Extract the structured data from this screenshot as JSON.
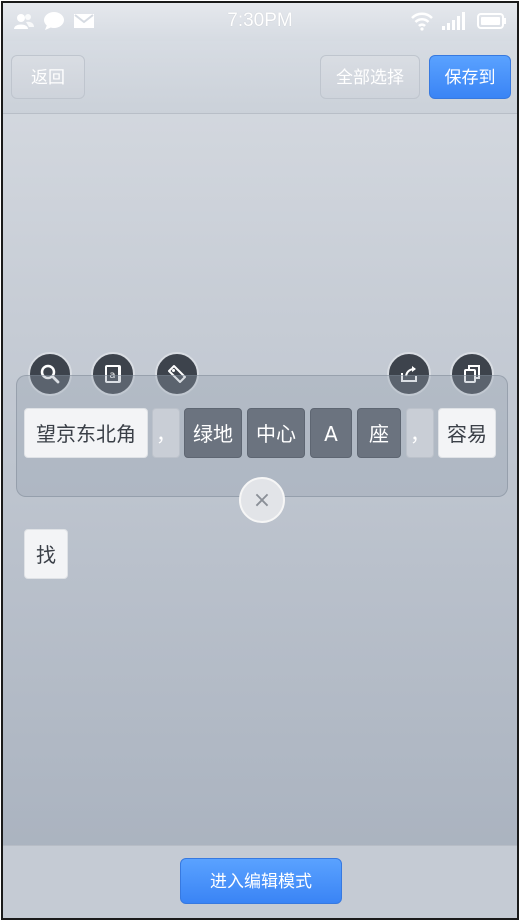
{
  "status_bar": {
    "time": "7:30PM",
    "icons": [
      "contacts-icon",
      "chat-icon",
      "mail-icon",
      "wifi-icon",
      "signal-icon",
      "battery-icon"
    ]
  },
  "toolbar": {
    "back_label": "返回",
    "select_all_label": "全部选择",
    "save_to_label": "保存到"
  },
  "selection_tools": [
    "search-icon",
    "dictionary-icon",
    "tag-icon",
    "share-icon",
    "copy-icon"
  ],
  "tokens": [
    {
      "text": "望京东北角",
      "state": "unselected"
    },
    {
      "text": "，",
      "state": "punctuation"
    },
    {
      "text": "绿地",
      "state": "selected"
    },
    {
      "text": "中心",
      "state": "selected"
    },
    {
      "text": "A",
      "state": "selected"
    },
    {
      "text": "座",
      "state": "selected"
    },
    {
      "text": "，",
      "state": "punctuation"
    },
    {
      "text": "容易",
      "state": "unselected"
    },
    {
      "text": "找",
      "state": "unselected"
    }
  ],
  "close_symbol": "×",
  "bottom": {
    "edit_mode_label": "进入编辑模式"
  },
  "colors": {
    "accent": "#3a84f5",
    "selected_token": "#6b737f",
    "tool_circle": "#3d434c"
  }
}
